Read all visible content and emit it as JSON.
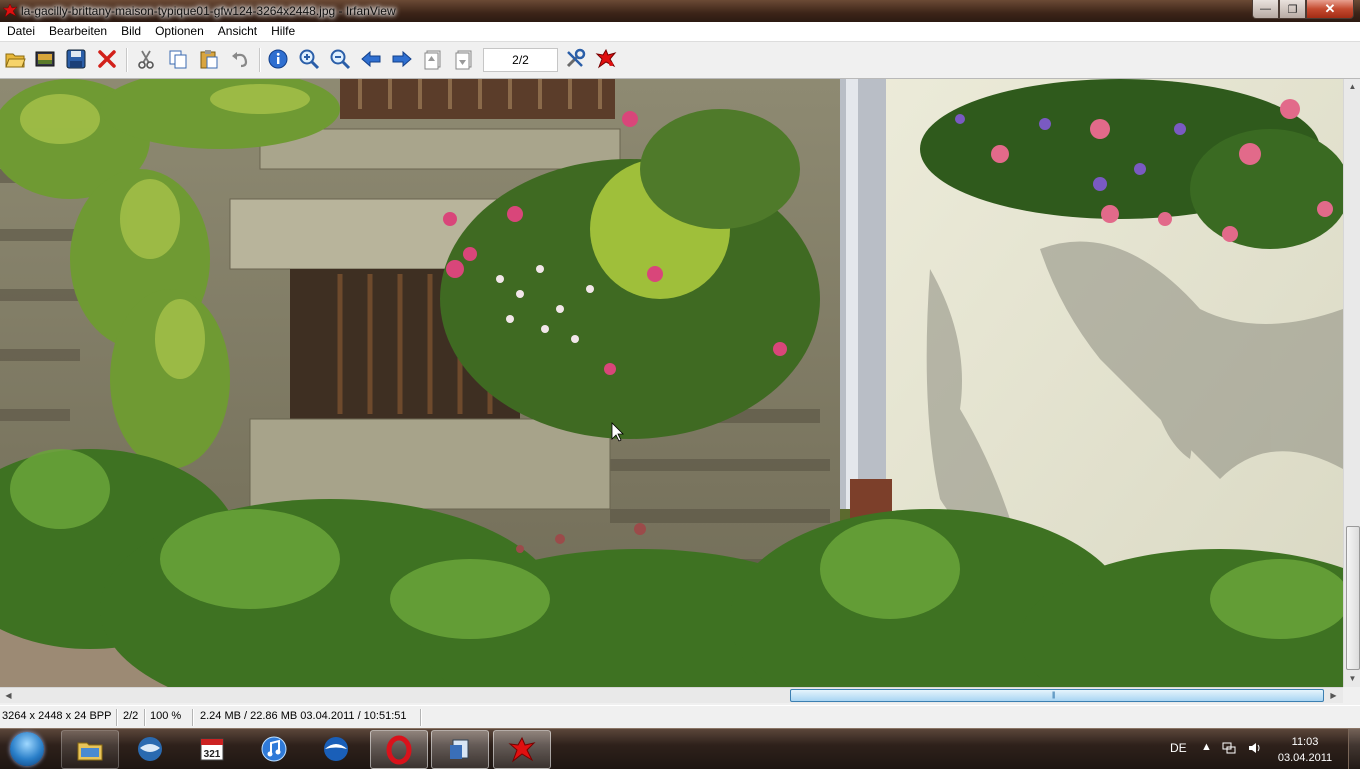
{
  "window": {
    "title": "la-gacilly-brittany-maison-typique01-gfw124-3264x2448.jpg - IrfanView",
    "minimize_label": "—",
    "maximize_label": "❐",
    "close_label": "✕"
  },
  "menu": {
    "items": [
      {
        "label": "Datei"
      },
      {
        "label": "Bearbeiten"
      },
      {
        "label": "Bild"
      },
      {
        "label": "Optionen"
      },
      {
        "label": "Ansicht"
      },
      {
        "label": "Hilfe"
      }
    ]
  },
  "toolbar": {
    "icons": [
      "open-folder-icon",
      "thumbnails-icon",
      "save-icon",
      "delete-icon",
      "cut-icon",
      "copy-icon",
      "paste-icon",
      "undo-icon",
      "info-icon",
      "zoom-in-icon",
      "zoom-out-icon",
      "previous-icon",
      "next-icon",
      "page-previous-icon",
      "page-next-icon",
      "settings-icon",
      "irfanview-logo-icon"
    ],
    "page_value": "2/2"
  },
  "image": {
    "description_icon": "photo-viewport"
  },
  "status": {
    "dimensions": "3264 x 2448 x 24 BPP",
    "page": "2/2",
    "zoom": "100 %",
    "file_info": "2.24 MB / 22.86 MB 03.04.2011 / 10:51:51"
  },
  "scrollbars": {
    "vertical_position": 0.92,
    "horizontal_position": 0.58
  },
  "taskbar": {
    "apps": [
      "explorer-folder-icon",
      "thunderbird-icon",
      "calendar-321-icon",
      "itunes-icon",
      "browser-icon",
      "opera-icon",
      "network-drive-icon",
      "irfanview-icon"
    ],
    "language": "DE",
    "time": "11:03",
    "date": "03.04.2011"
  },
  "colors": {
    "titlebar": "#3c2418",
    "taskbar": "#2e211b",
    "hscroll_thumb": "#a9d5f3",
    "accent_blue": "#3c7fb1"
  }
}
